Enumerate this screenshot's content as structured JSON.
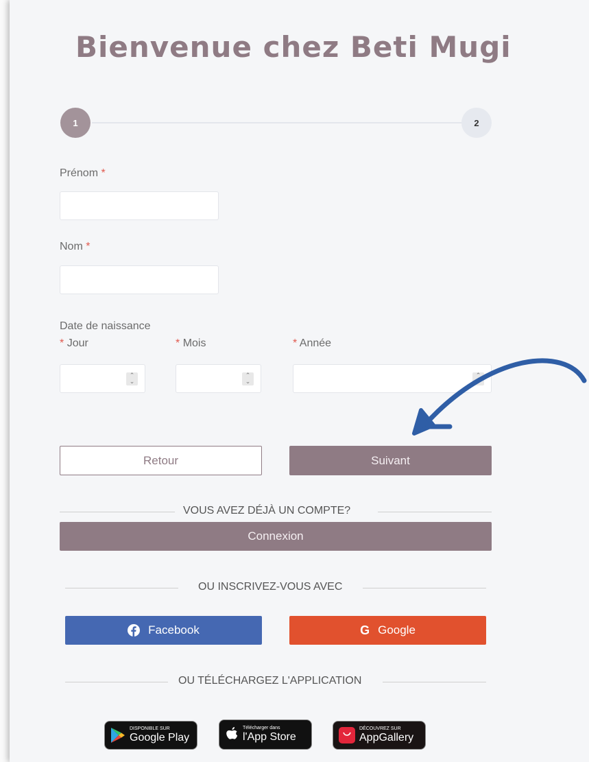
{
  "header": {
    "title": "Bienvenue chez Beti Mugi"
  },
  "stepper": {
    "step1": "1",
    "step2": "2"
  },
  "form": {
    "first_name_label": "Prénom",
    "last_name_label": "Nom",
    "required_mark": "*",
    "dob_label": "Date de naissance",
    "day_label": "Jour",
    "month_label": "Mois",
    "year_label": "Année",
    "first_name_value": "",
    "last_name_value": ""
  },
  "actions": {
    "back_label": "Retour",
    "next_label": "Suivant"
  },
  "account": {
    "divider": "VOUS AVEZ DÉJÀ UN COMPTE?",
    "login_label": "Connexion"
  },
  "social": {
    "divider": "OU INSCRIVEZ-VOUS AVEC",
    "facebook_label": "Facebook",
    "google_label": "Google"
  },
  "apps": {
    "divider": "OU TÉLÉCHARGEZ L'APPLICATION",
    "google_play_small": "DISPONIBLE SUR",
    "google_play_big": "Google Play",
    "app_store_small": "Télécharger dans",
    "app_store_big": "l'App Store",
    "app_gallery_small": "DÉCOUVREZ SUR",
    "app_gallery_big": "AppGallery"
  },
  "colors": {
    "brand": "#8f7b84",
    "facebook": "#4568b2",
    "google": "#e1512e",
    "required": "#e15a4f",
    "arrow": "#2f5ea6"
  },
  "icons": [
    "facebook-icon",
    "google-icon",
    "google-play-icon",
    "apple-icon",
    "huawei-icon",
    "curved-arrow-icon",
    "spin-arrows-icon"
  ]
}
